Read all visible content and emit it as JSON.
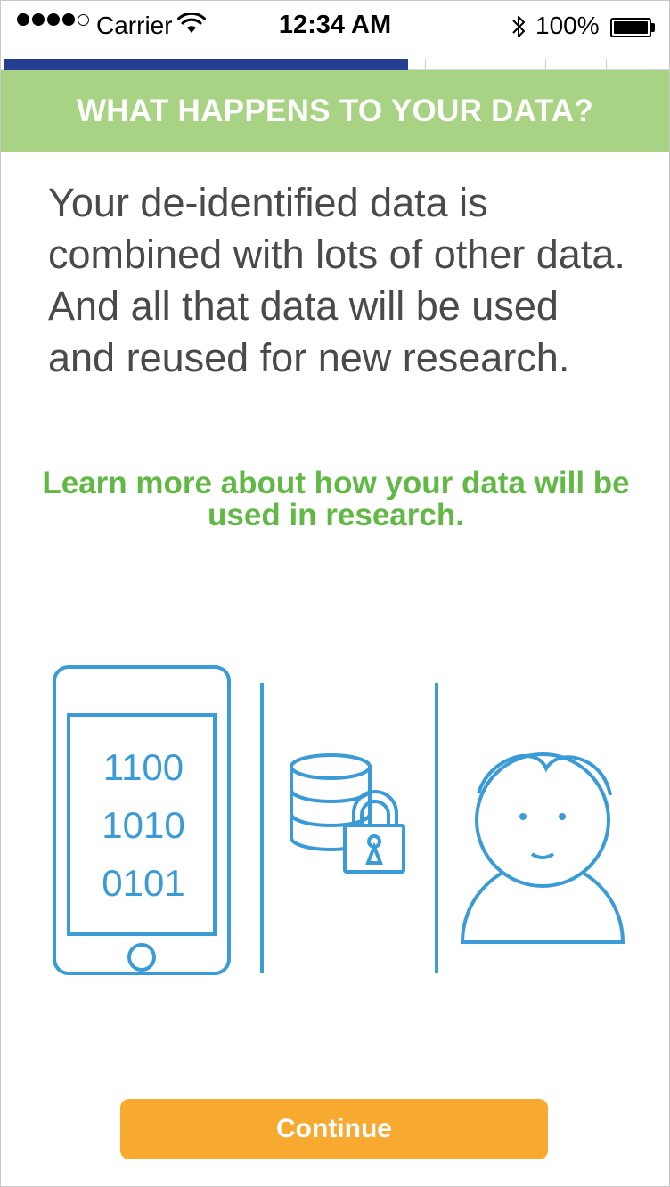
{
  "status_bar": {
    "carrier": "Carrier",
    "time": "12:34 AM",
    "battery_text": "100%",
    "signal_bars_filled": 4,
    "signal_bars_total": 5,
    "battery_level": 1.0
  },
  "progress": {
    "completed_fraction": 0.61,
    "segments_total": 11
  },
  "header": {
    "title": "WHAT HAPPENS TO YOUR DATA?"
  },
  "body": {
    "text": "Your de-identified data is combined with lots of other data. And all that data will be used and reused for new re­search."
  },
  "link": {
    "text": "Learn more about how your data will be used in research."
  },
  "illustration": {
    "binary_lines": [
      "1100",
      "1010",
      "0101"
    ],
    "icons": [
      "phone-icon",
      "database-icon",
      "lock-icon",
      "person-icon"
    ]
  },
  "footer": {
    "continue_label": "Continue"
  },
  "colors": {
    "header_bg": "#a8d385",
    "progress_fill": "#243e91",
    "link": "#62b845",
    "illustration": "#3a9bd7",
    "button": "#f8a930",
    "body_text": "#4a4a4a"
  }
}
